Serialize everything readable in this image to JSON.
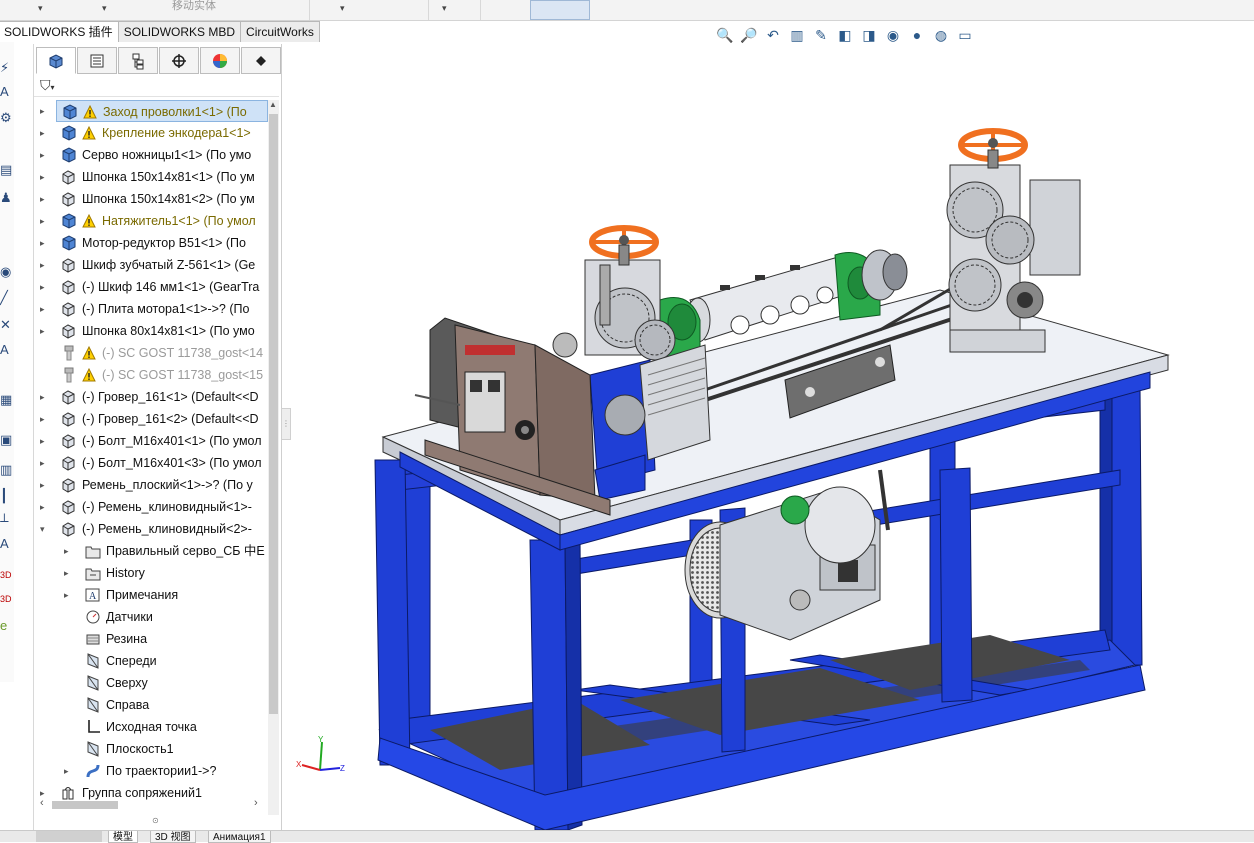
{
  "ribbon": {
    "move_label": "移动实体",
    "dropdown_glyph": "▾"
  },
  "tabs": [
    {
      "label": "SOLIDWORKS 插件"
    },
    {
      "label": "SOLIDWORKS MBD"
    },
    {
      "label": "CircuitWorks"
    }
  ],
  "feature_tree": {
    "items": [
      {
        "label": "Заход проволки1<1> (По",
        "warn": true,
        "selected": true
      },
      {
        "label": "Крепление энкодера1<1>",
        "warn": true
      },
      {
        "label": "Серво ножницы1<1> (По умо"
      },
      {
        "label": "Шпонка 150x14x81<1> (По ум"
      },
      {
        "label": "Шпонка 150x14x81<2> (По ум"
      },
      {
        "label": "Натяжитель1<1> (По умол",
        "warn": true
      },
      {
        "label": "Мотор-редуктор B51<1> (По"
      },
      {
        "label": "Шкиф зубчатый Z-561<1> (Ge"
      },
      {
        "label": "(-) Шкиф 146 мм1<1> (GearTra"
      },
      {
        "label": "(-) Плита мотора1<1>->? (По"
      },
      {
        "label": "Шпонка 80x14x81<1> (По умо"
      },
      {
        "label": "(-) SC GOST 11738_gost<14",
        "warn": true,
        "grey": true
      },
      {
        "label": "(-) SC GOST 11738_gost<15",
        "warn": true,
        "grey": true
      },
      {
        "label": "(-) Гровер_161<1> (Default<<D"
      },
      {
        "label": "(-) Гровер_161<2> (Default<<D"
      },
      {
        "label": "(-) Болт_M16x401<1> (По умол"
      },
      {
        "label": "(-) Болт_M16x401<3> (По умол"
      },
      {
        "label": "Ремень_плоский<1>->? (По у"
      },
      {
        "label": "(-) Ремень_клиновидный<1>-"
      },
      {
        "label": "(-) Ремень_клиновидный<2>-"
      },
      {
        "label": "Правильный серво_СБ 中E"
      },
      {
        "label": "History"
      },
      {
        "label": "Примечания"
      },
      {
        "label": "Датчики"
      },
      {
        "label": "Резина"
      },
      {
        "label": "Спереди"
      },
      {
        "label": "Сверху"
      },
      {
        "label": "Справа"
      },
      {
        "label": "Исходная точка"
      },
      {
        "label": "Плоскость1"
      },
      {
        "label": "По траектории1->?"
      },
      {
        "label": "Группа сопряжений1"
      }
    ]
  },
  "bottom_tabs": [
    {
      "label": "模型"
    },
    {
      "label": "3D 视图"
    },
    {
      "label": "Анимация1"
    }
  ],
  "colors": {
    "frame_blue": "#1f3fd6",
    "frame_dark": "#1530a8",
    "table_top": "#e9edf4",
    "handwheel": "#f07020",
    "bearing_green": "#2aa84a",
    "motor": "#c9ced6"
  }
}
